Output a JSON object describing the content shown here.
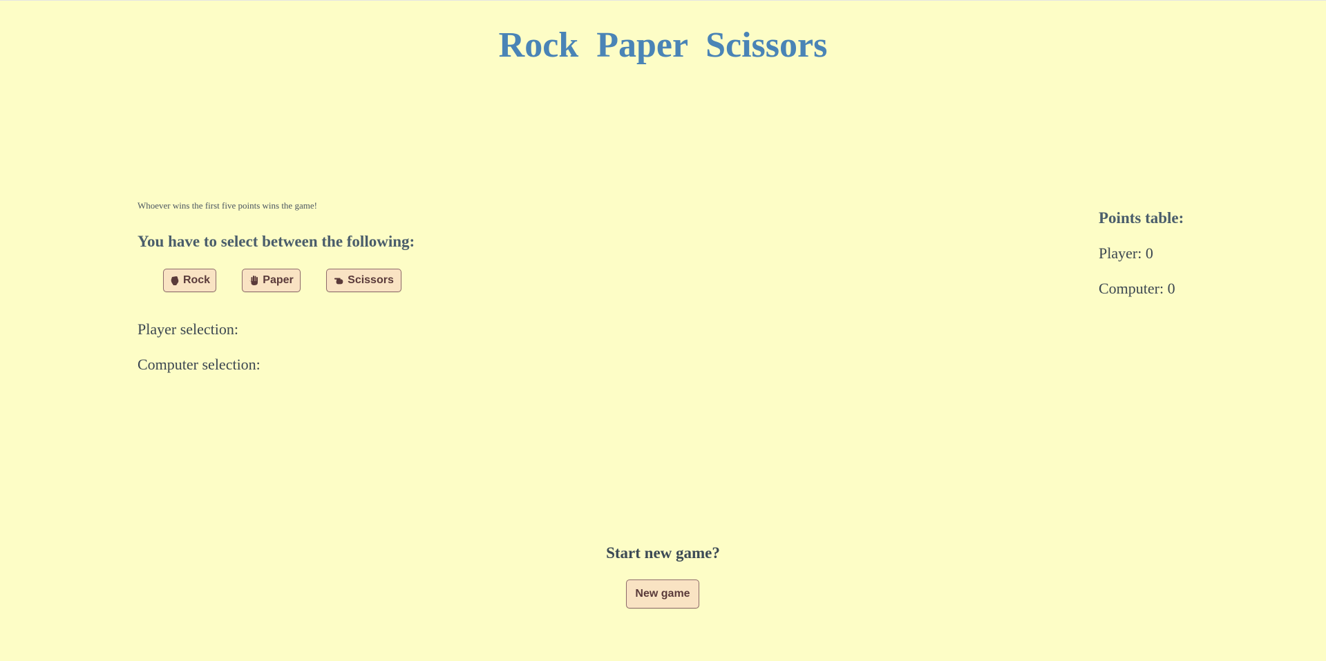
{
  "title": "Rock  Paper  Scissors",
  "rules_text": "Whoever wins the first five points wins the game!",
  "select_heading": "You have to select between the following:",
  "choices": [
    {
      "label": "Rock",
      "icon": "fist-icon"
    },
    {
      "label": "Paper",
      "icon": "raised-hand-icon"
    },
    {
      "label": "Scissors",
      "icon": "pointing-hand-icon"
    }
  ],
  "selections": {
    "player_label": "Player selection:",
    "computer_label": "Computer selection:"
  },
  "points": {
    "title": "Points table:",
    "player": "Player: 0",
    "computer": "Computer: 0"
  },
  "new_game": {
    "heading": "Start new game?",
    "button_label": "New game"
  },
  "colors": {
    "background": "#fdfdc6",
    "title": "#4a84b6",
    "button_bg": "#f9e3c3",
    "button_text": "#5a3a3a"
  }
}
